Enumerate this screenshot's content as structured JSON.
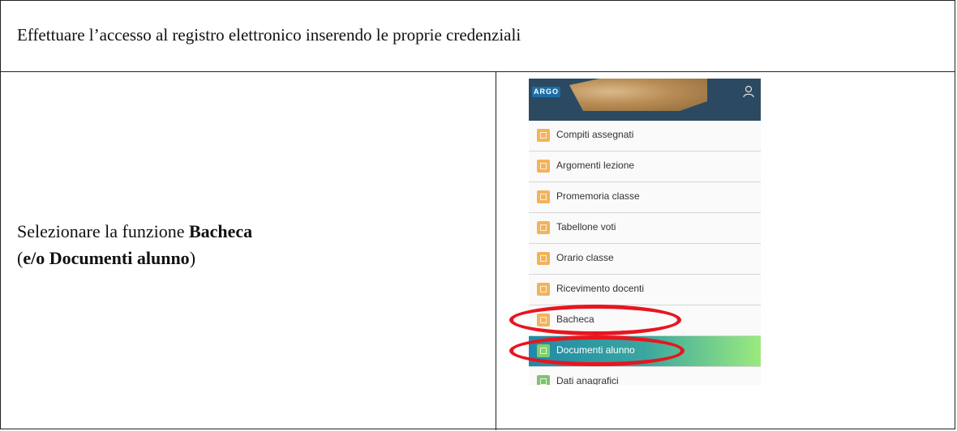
{
  "header_text": "Effettuare l’accesso al registro elettronico inserendo le proprie credenziali",
  "instruction": {
    "prefix": "Selezionare la funzione ",
    "bold1": "Bacheca",
    "open_paren": "(",
    "bold2": "e/o Documenti alunno",
    "close_paren": ")"
  },
  "app": {
    "logo": "ARGO",
    "menu": [
      {
        "label": "Compiti assegnati",
        "icon": "assignments-icon"
      },
      {
        "label": "Argomenti lezione",
        "icon": "lesson-topics-icon"
      },
      {
        "label": "Promemoria classe",
        "icon": "class-reminder-icon"
      },
      {
        "label": "Tabellone voti",
        "icon": "grades-board-icon"
      },
      {
        "label": "Orario classe",
        "icon": "class-schedule-icon"
      },
      {
        "label": "Ricevimento docenti",
        "icon": "teacher-meeting-icon"
      },
      {
        "label": "Bacheca",
        "icon": "bulletin-board-icon"
      },
      {
        "label": "Documenti alunno",
        "icon": "student-documents-icon",
        "active": true
      },
      {
        "label": "Dati anagrafici",
        "icon": "personal-data-icon"
      }
    ]
  },
  "colors": {
    "header_bg": "#2b4a62",
    "highlight": "#e8151f",
    "active_start": "#1f8aa8",
    "active_end": "#9bea7e"
  }
}
